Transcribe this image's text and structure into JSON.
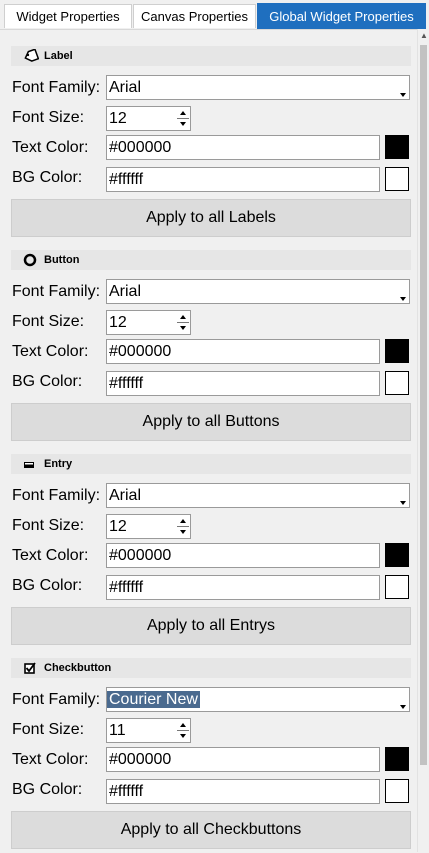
{
  "tabs": [
    {
      "label": "Widget Properties"
    },
    {
      "label": "Canvas Properties"
    },
    {
      "label": "Global Widget Properties",
      "active": true
    }
  ],
  "labels": {
    "font_family": "Font Family:",
    "font_size": "Font Size:",
    "text_color": "Text Color:",
    "bg_color": "BG Color:"
  },
  "sections": [
    {
      "name": "Label",
      "icon": "tag-icon",
      "font_family": "Arial",
      "font_size": "12",
      "text_color": "#000000",
      "bg_color": "#ffffff",
      "apply_label": "Apply to all Labels"
    },
    {
      "name": "Button",
      "icon": "circle-icon",
      "font_family": "Arial",
      "font_size": "12",
      "text_color": "#000000",
      "bg_color": "#ffffff",
      "apply_label": "Apply to all Buttons"
    },
    {
      "name": "Entry",
      "icon": "entry-icon",
      "font_family": "Arial",
      "font_size": "12",
      "text_color": "#000000",
      "bg_color": "#ffffff",
      "apply_label": "Apply to all Entrys"
    },
    {
      "name": "Checkbutton",
      "icon": "checkbox-icon",
      "font_family": "Courier New",
      "font_size": "11",
      "text_color": "#000000",
      "bg_color": "#ffffff",
      "apply_label": "Apply to all Checkbuttons"
    }
  ],
  "colors": {
    "active_tab": "#1f6fbf",
    "selection": "#4a6a8f"
  }
}
